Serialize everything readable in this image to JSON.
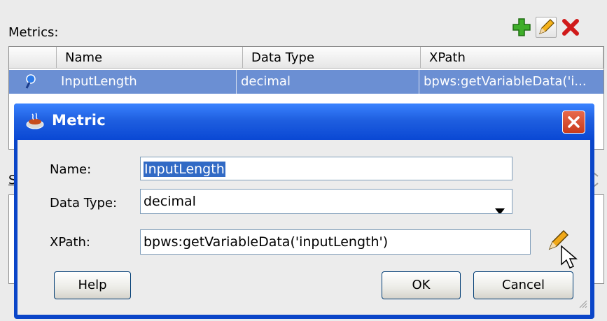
{
  "metrics": {
    "label": "Metrics:",
    "columns": [
      "Name",
      "Data Type",
      "XPath"
    ],
    "rows": [
      {
        "name": "InputLength",
        "data_type": "decimal",
        "xpath": "bpws:getVariableData('i..."
      }
    ]
  },
  "snapshots": {
    "label_partial": "Sna"
  },
  "dialog": {
    "title": "Metric",
    "name_label": "Name:",
    "name_value": "InputLength",
    "datatype_label": "Data Type:",
    "datatype_value": "decimal",
    "xpath_label": "XPath:",
    "xpath_value": "bpws:getVariableData('inputLength')",
    "help_label": "Help",
    "ok_label": "OK",
    "cancel_label": "Cancel"
  },
  "colors": {
    "titlebar": "#1f5fe0",
    "selection": "#316ac5",
    "row_highlight": "#6b8fd3",
    "close_button": "#d4502f"
  },
  "icons": [
    "add-icon",
    "edit-icon",
    "delete-icon",
    "metric-icon",
    "java-cup-icon",
    "close-icon",
    "chevron-down-icon",
    "pencil-icon",
    "cursor-icon",
    "cube-icon"
  ]
}
